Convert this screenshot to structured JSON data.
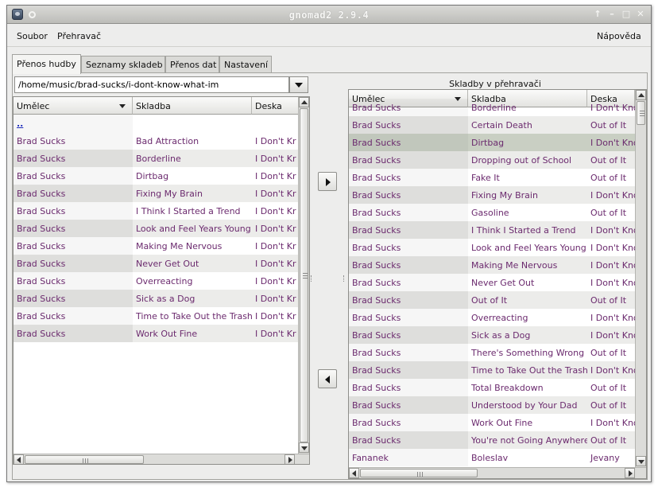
{
  "window": {
    "title": "gnomad2 2.9.4",
    "controls": {
      "help": "↑",
      "minimize": "–",
      "maximize": "□",
      "close": "✕"
    }
  },
  "menubar": {
    "file": "Soubor",
    "player": "Přehravač",
    "help": "Nápověda"
  },
  "tabs": [
    {
      "label": "Přenos hudby",
      "active": true
    },
    {
      "label": "Seznamy skladeb",
      "active": false
    },
    {
      "label": "Přenos dat",
      "active": false
    },
    {
      "label": "Nastavení",
      "active": false
    }
  ],
  "left_panel": {
    "path": "/home/music/brad-sucks/i-dont-know-what-im",
    "columns": {
      "artist": "Umělec",
      "track": "Skladba",
      "album": "Deska"
    },
    "parent_dir": "..",
    "rows": [
      {
        "artist": "Brad Sucks",
        "track": "Bad Attraction",
        "album": "I Don't Kr"
      },
      {
        "artist": "Brad Sucks",
        "track": "Borderline",
        "album": "I Don't Kr"
      },
      {
        "artist": "Brad Sucks",
        "track": "Dirtbag",
        "album": "I Don't Kr"
      },
      {
        "artist": "Brad Sucks",
        "track": "Fixing My Brain",
        "album": "I Don't Kr"
      },
      {
        "artist": "Brad Sucks",
        "track": "I Think I Started a Trend",
        "album": "I Don't Kr"
      },
      {
        "artist": "Brad Sucks",
        "track": "Look and Feel Years Young",
        "album": "I Don't Kr"
      },
      {
        "artist": "Brad Sucks",
        "track": "Making Me Nervous",
        "album": "I Don't Kr"
      },
      {
        "artist": "Brad Sucks",
        "track": "Never Get Out",
        "album": "I Don't Kr"
      },
      {
        "artist": "Brad Sucks",
        "track": "Overreacting",
        "album": "I Don't Kr"
      },
      {
        "artist": "Brad Sucks",
        "track": "Sick as a Dog",
        "album": "I Don't Kr"
      },
      {
        "artist": "Brad Sucks",
        "track": "Time to Take Out the Trash",
        "album": "I Don't Kr"
      },
      {
        "artist": "Brad Sucks",
        "track": "Work Out Fine",
        "album": "I Don't Kr"
      }
    ]
  },
  "right_panel": {
    "caption": "Skladby v přehravači",
    "columns": {
      "artist": "Umělec",
      "track": "Skladba",
      "album": "Deska"
    },
    "selected_index": 2,
    "rows": [
      {
        "artist": "Brad Sucks",
        "track": "Borderline",
        "album": "I Don't Know"
      },
      {
        "artist": "Brad Sucks",
        "track": "Certain Death",
        "album": "Out of It"
      },
      {
        "artist": "Brad Sucks",
        "track": "Dirtbag",
        "album": "I Don't Know"
      },
      {
        "artist": "Brad Sucks",
        "track": "Dropping out of School",
        "album": "Out of It"
      },
      {
        "artist": "Brad Sucks",
        "track": "Fake It",
        "album": "Out of It"
      },
      {
        "artist": "Brad Sucks",
        "track": "Fixing My Brain",
        "album": "I Don't Know"
      },
      {
        "artist": "Brad Sucks",
        "track": "Gasoline",
        "album": "Out of It"
      },
      {
        "artist": "Brad Sucks",
        "track": "I Think I Started a Trend",
        "album": "I Don't Know"
      },
      {
        "artist": "Brad Sucks",
        "track": "Look and Feel Years Young",
        "album": "I Don't Know"
      },
      {
        "artist": "Brad Sucks",
        "track": "Making Me Nervous",
        "album": "I Don't Know"
      },
      {
        "artist": "Brad Sucks",
        "track": "Never Get Out",
        "album": "I Don't Know"
      },
      {
        "artist": "Brad Sucks",
        "track": "Out of It",
        "album": "Out of It"
      },
      {
        "artist": "Brad Sucks",
        "track": "Overreacting",
        "album": "I Don't Know"
      },
      {
        "artist": "Brad Sucks",
        "track": "Sick as a Dog",
        "album": "I Don't Know"
      },
      {
        "artist": "Brad Sucks",
        "track": "There's Something Wrong",
        "album": "Out of It"
      },
      {
        "artist": "Brad Sucks",
        "track": "Time to Take Out the Trash",
        "album": "I Don't Know"
      },
      {
        "artist": "Brad Sucks",
        "track": "Total Breakdown",
        "album": "Out of It"
      },
      {
        "artist": "Brad Sucks",
        "track": "Understood by Your Dad",
        "album": "Out of It"
      },
      {
        "artist": "Brad Sucks",
        "track": "Work Out Fine",
        "album": "I Don't Know"
      },
      {
        "artist": "Brad Sucks",
        "track": "You're not Going Anywhere",
        "album": "Out of It"
      },
      {
        "artist": "Fananek",
        "track": "Boleslav",
        "album": "Jevany"
      }
    ]
  },
  "icons": {
    "transfer_to_player": "triangle-right-icon",
    "transfer_to_computer": "triangle-left-icon",
    "combo_dropdown": "triangle-down-icon",
    "sort": "sort-descending-icon"
  }
}
